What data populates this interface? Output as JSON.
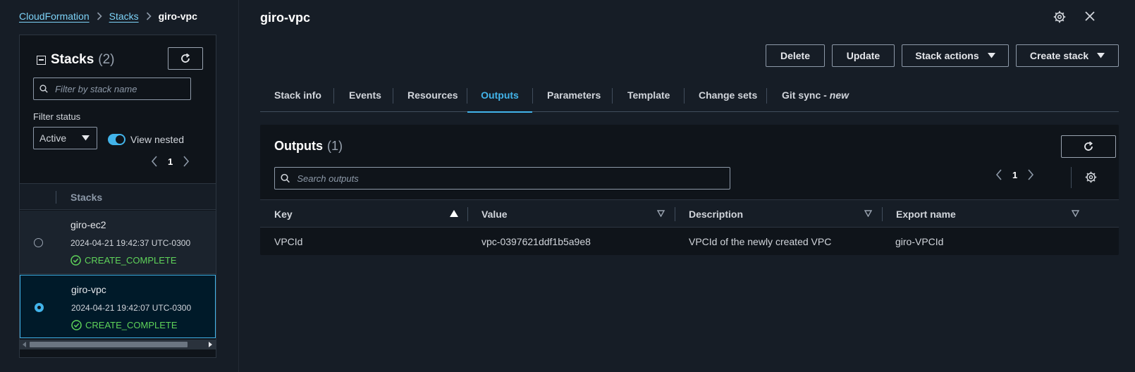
{
  "breadcrumb": {
    "items": [
      "CloudFormation",
      "Stacks"
    ],
    "current": "giro-vpc"
  },
  "stacks_panel": {
    "title": "Stacks",
    "count": "(2)",
    "filter_placeholder": "Filter by stack name",
    "filter_status_label": "Filter status",
    "filter_status_value": "Active",
    "view_nested_label": "View nested",
    "view_nested_enabled": true,
    "page": "1",
    "column_header": "Stacks",
    "rows": [
      {
        "name": "giro-ec2",
        "time": "2024-04-21 19:42:37 UTC-0300",
        "status": "CREATE_COMPLETE",
        "selected": false
      },
      {
        "name": "giro-vpc",
        "time": "2024-04-21 19:42:07 UTC-0300",
        "status": "CREATE_COMPLETE",
        "selected": true
      }
    ]
  },
  "page": {
    "title": "giro-vpc",
    "actions": {
      "delete": "Delete",
      "update": "Update",
      "stack_actions": "Stack actions",
      "create_stack": "Create stack"
    },
    "tabs": [
      {
        "label": "Stack info"
      },
      {
        "label": "Events"
      },
      {
        "label": "Resources"
      },
      {
        "label": "Outputs",
        "active": true
      },
      {
        "label": "Parameters"
      },
      {
        "label": "Template"
      },
      {
        "label": "Change sets"
      },
      {
        "label": "Git sync -",
        "badge": "new"
      }
    ]
  },
  "outputs": {
    "title": "Outputs",
    "count": "(1)",
    "search_placeholder": "Search outputs",
    "page": "1",
    "columns": [
      "Key",
      "Value",
      "Description",
      "Export name"
    ],
    "rows": [
      [
        "VPCId",
        "vpc-0397621ddf1b5a9e8",
        "VPCId of the newly created VPC",
        "giro-VPCId"
      ]
    ]
  },
  "colors": {
    "accent": "#42b4ea",
    "success": "#5fd35a",
    "background": "#161d26",
    "panel": "#0f141a"
  },
  "icons": [
    "refresh-icon",
    "search-icon",
    "caret-down-icon",
    "chevron-left-icon",
    "chevron-right-icon",
    "check-circle-icon",
    "gear-icon",
    "close-icon",
    "sort-ascending-icon",
    "sort-icon"
  ]
}
